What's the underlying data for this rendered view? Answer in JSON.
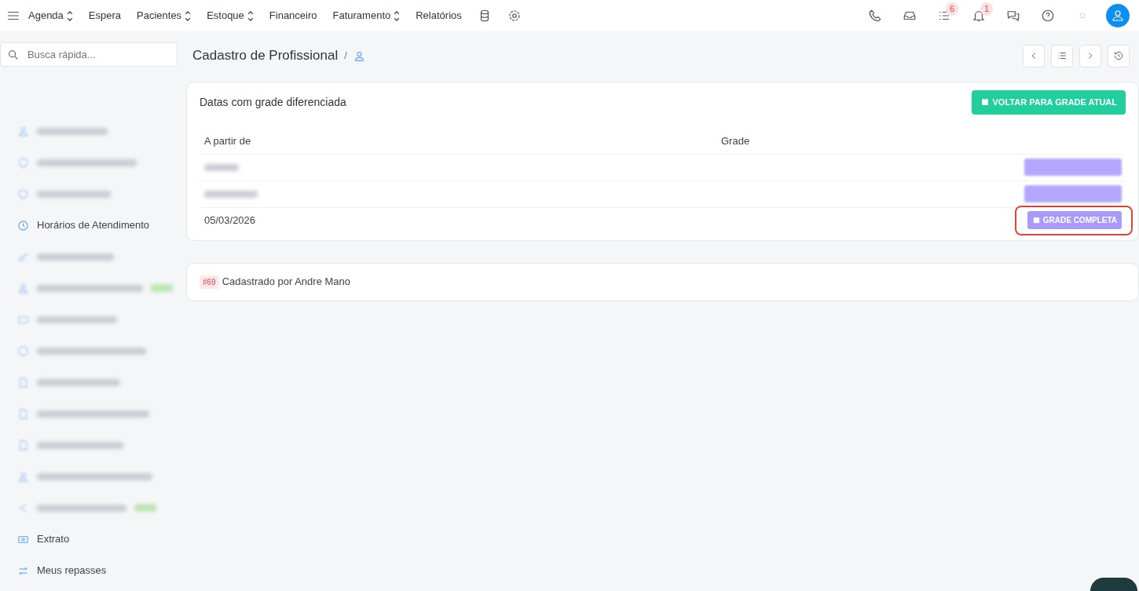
{
  "topnav": {
    "items": [
      {
        "label": "Agenda",
        "dropdown": true
      },
      {
        "label": "Espera",
        "dropdown": false
      },
      {
        "label": "Pacientes",
        "dropdown": true
      },
      {
        "label": "Estoque",
        "dropdown": true
      },
      {
        "label": "Financeiro",
        "dropdown": false
      },
      {
        "label": "Faturamento",
        "dropdown": true
      },
      {
        "label": "Relatórios",
        "dropdown": false
      }
    ],
    "badges": [
      {
        "count": "6"
      },
      {
        "count": "1"
      }
    ]
  },
  "sidebar": {
    "search": {
      "placeholder": "Busca rápida..."
    },
    "items": [
      {
        "blurred": true,
        "badge": false
      },
      {
        "blurred": true,
        "badge": false
      },
      {
        "blurred": true,
        "badge": false
      },
      {
        "blurred": false,
        "label": "Horários de Atendimento",
        "badge": false
      },
      {
        "blurred": true,
        "badge": false
      },
      {
        "blurred": true,
        "badge": true
      },
      {
        "blurred": true,
        "badge": false
      },
      {
        "blurred": true,
        "badge": false
      },
      {
        "blurred": true,
        "badge": false
      },
      {
        "blurred": true,
        "badge": false
      },
      {
        "blurred": true,
        "badge": false
      },
      {
        "blurred": true,
        "badge": false
      },
      {
        "blurred": true,
        "badge": true
      },
      {
        "blurred": false,
        "label": "Extrato",
        "badge": false
      },
      {
        "blurred": false,
        "label": "Meus repasses",
        "badge": false
      }
    ]
  },
  "page": {
    "title": "Cadastro de Profissional",
    "separator": "/"
  },
  "grid_card": {
    "title": "Datas com grade diferenciada",
    "action": "VOLTAR PARA GRADE ATUAL",
    "columns": [
      "A partir de",
      "Grade"
    ],
    "rows": [
      {
        "blurred": true,
        "highlighted": false
      },
      {
        "blurred": true,
        "highlighted": false
      },
      {
        "blurred": false,
        "date": "05/03/2026",
        "button": "GRADE COMPLETA",
        "highlighted": true
      }
    ]
  },
  "footer_card": {
    "id": "#69",
    "text": "Cadastrado por Andre Mano"
  }
}
